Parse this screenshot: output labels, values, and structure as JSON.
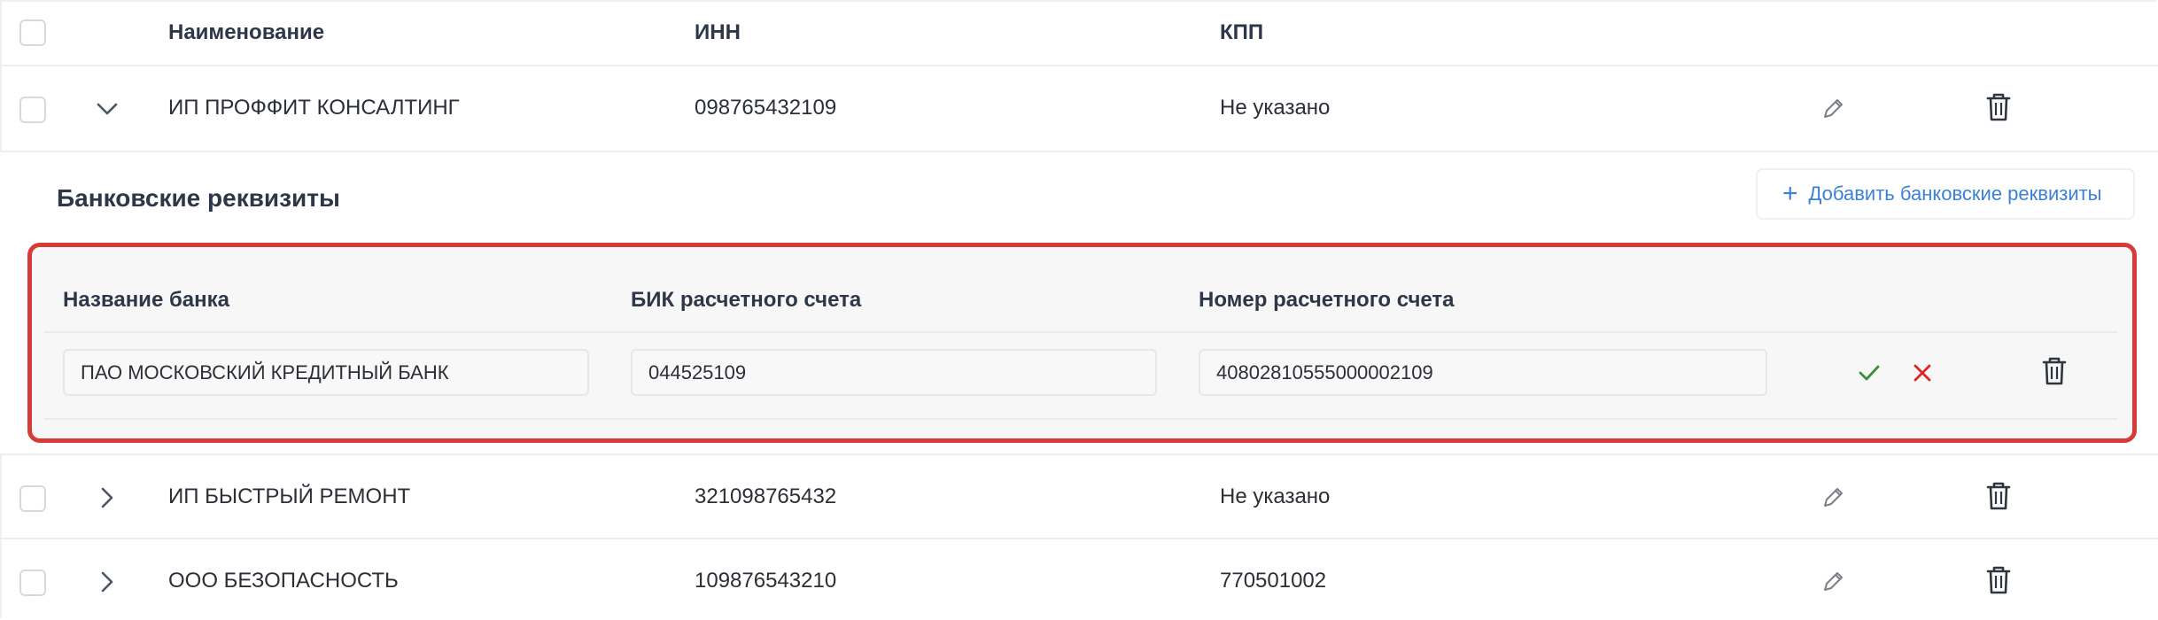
{
  "table": {
    "headers": {
      "name": "Наименование",
      "inn": "ИНН",
      "kpp": "КПП"
    },
    "rows": [
      {
        "name": "ИП ПРОФФИТ КОНСАЛТИНГ",
        "inn": "098765432109",
        "kpp": "Не указано",
        "expanded": true
      },
      {
        "name": "ИП БЫСТРЫЙ РЕМОНТ",
        "inn": "321098765432",
        "kpp": "Не указано",
        "expanded": false
      },
      {
        "name": "ООО БЕЗОПАСНОСТЬ",
        "inn": "109876543210",
        "kpp": "770501002",
        "expanded": false
      }
    ]
  },
  "bank_section": {
    "title": "Банковские реквизиты",
    "add_button_label": "Добавить банковские реквизиты",
    "columns": {
      "bank_name": "Название банка",
      "bik": "БИК расчетного счета",
      "account_number": "Номер расчетного счета"
    },
    "entry": {
      "bank_name": "ПАО МОСКОВСКИЙ КРЕДИТНЫЙ БАНК",
      "bik": "044525109",
      "account_number": "40802810555000002109"
    }
  },
  "icons": {
    "chevron_expanded": "chevron-down-icon",
    "chevron_collapsed": "chevron-right-icon",
    "edit": "pencil-icon",
    "delete": "trash-icon",
    "add": "plus-icon",
    "confirm": "checkmark-icon",
    "cancel": "close-icon"
  },
  "colors": {
    "accent": "#3b82d6",
    "highlight_border": "#d53b37",
    "confirm": "#3c8d3a",
    "cancel": "#dc2626"
  }
}
